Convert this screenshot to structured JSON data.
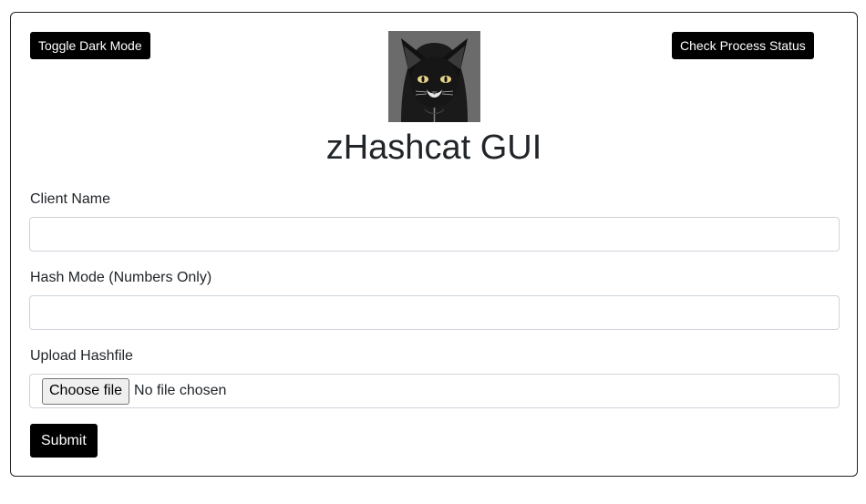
{
  "header": {
    "toggle_dark_mode_label": "Toggle Dark Mode",
    "check_status_label": "Check Process Status",
    "title": "zHashcat GUI"
  },
  "form": {
    "client_name": {
      "label": "Client Name",
      "value": "",
      "placeholder": ""
    },
    "hash_mode": {
      "label": "Hash Mode (Numbers Only)",
      "value": "",
      "placeholder": ""
    },
    "hashfile": {
      "label": "Upload Hashfile",
      "button_label": "Choose file",
      "status": "No file chosen"
    },
    "submit_label": "Submit"
  },
  "colors": {
    "button_bg": "#000000",
    "button_text": "#ffffff",
    "border": "#ced4da",
    "text": "#212529",
    "logo_bg": "#6b6b6b"
  },
  "icons": {
    "logo": "hooded-black-cat-logo"
  }
}
